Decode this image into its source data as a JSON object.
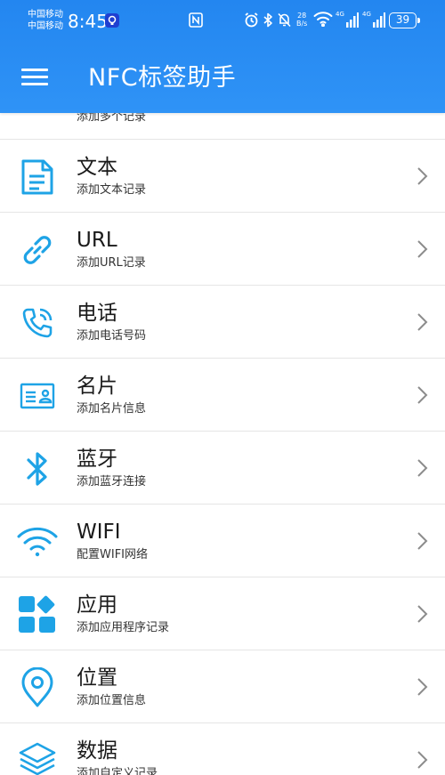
{
  "status_bar": {
    "carrier_1": "中国移动",
    "carrier_2": "中国移动",
    "time": "8:45",
    "net_speed_value": "28",
    "net_speed_unit": "B/s",
    "signal_1": "4G",
    "signal_2": "4G",
    "battery": "39"
  },
  "app_bar": {
    "title": "NFC标签助手",
    "menu_icon": "hamburger-menu-icon"
  },
  "accent_color": "#2a8ef4",
  "icon_color": "#1ea3e6",
  "list": [
    {
      "title": "",
      "subtitle": "添加多个记录",
      "icon": "multi-record-icon"
    },
    {
      "title": "文本",
      "subtitle": "添加文本记录",
      "icon": "document-icon"
    },
    {
      "title": "URL",
      "subtitle": "添加URL记录",
      "icon": "link-icon"
    },
    {
      "title": "电话",
      "subtitle": "添加电话号码",
      "icon": "phone-icon"
    },
    {
      "title": "名片",
      "subtitle": "添加名片信息",
      "icon": "contact-card-icon"
    },
    {
      "title": "蓝牙",
      "subtitle": "添加蓝牙连接",
      "icon": "bluetooth-icon"
    },
    {
      "title": "WIFI",
      "subtitle": "配置WIFI网络",
      "icon": "wifi-icon"
    },
    {
      "title": "应用",
      "subtitle": "添加应用程序记录",
      "icon": "apps-icon"
    },
    {
      "title": "位置",
      "subtitle": "添加位置信息",
      "icon": "location-pin-icon"
    },
    {
      "title": "数据",
      "subtitle": "添加自定义记录",
      "icon": "layers-icon"
    }
  ]
}
